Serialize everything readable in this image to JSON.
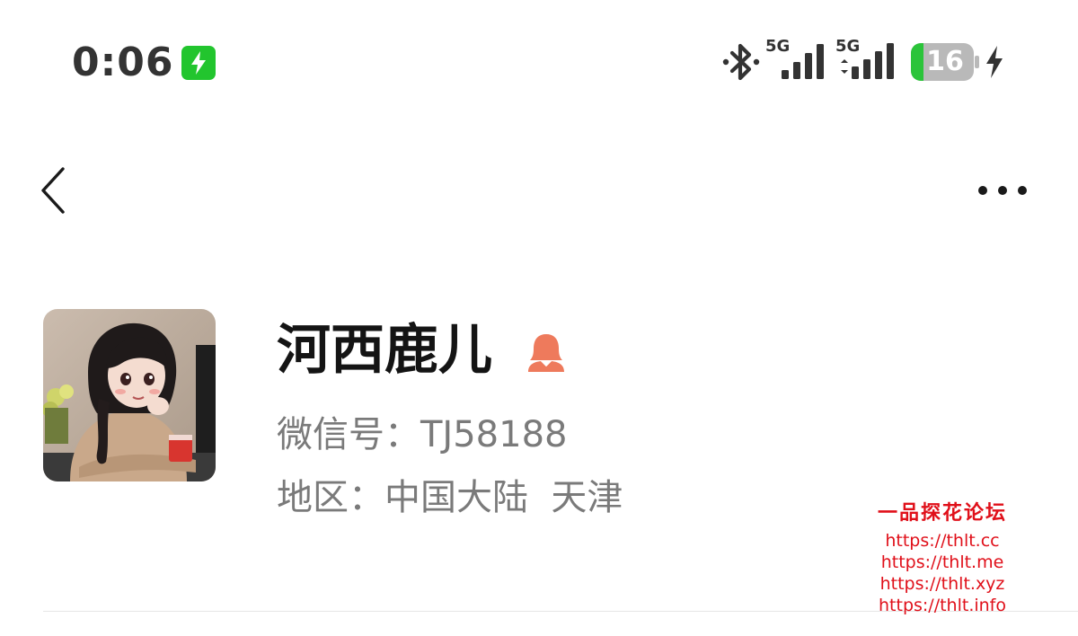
{
  "status_bar": {
    "time": "0:06",
    "network_1": "5G",
    "network_2": "5G",
    "battery_level": "16",
    "icons": [
      "charging-icon",
      "bluetooth-icon",
      "signal-icon",
      "signal-icon",
      "battery-icon",
      "bolt-icon"
    ],
    "colors": {
      "charging_badge": "#22c52e",
      "battery_fill": "#2bc43a",
      "battery_body": "#b9b9b9"
    }
  },
  "nav": {
    "icons": [
      "back-chevron-icon",
      "more-dots-icon"
    ]
  },
  "profile": {
    "name": "河西鹿儿",
    "gender_icon": "female-user-icon",
    "gender_color": "#ee7a5c",
    "wechat_id_line": "微信号：TJ58188",
    "region_line": "地区：中国大陆  天津"
  },
  "watermark": {
    "title": "一品探花论坛",
    "links": [
      "https://thlt.cc",
      "https://thlt.me",
      "https://thlt.xyz",
      "https://thlt.info"
    ]
  }
}
